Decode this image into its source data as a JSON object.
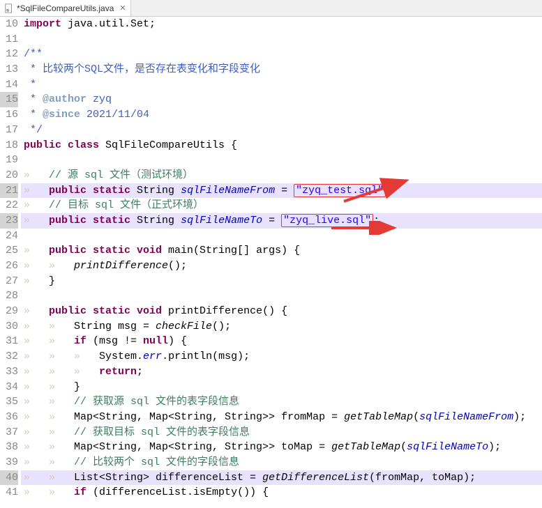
{
  "tab": {
    "title": "*SqlFileCompareUtils.java"
  },
  "firstLine": 10,
  "highlightGutterLines": [
    15,
    21,
    23,
    40
  ],
  "highlightCodeLines": [
    21,
    23,
    40
  ],
  "lines": [
    {
      "n": 10,
      "tokens": [
        {
          "t": "import ",
          "c": "kw"
        },
        {
          "t": "java.util.Set;"
        }
      ]
    },
    {
      "n": 11,
      "tokens": []
    },
    {
      "n": 12,
      "tokens": [
        {
          "t": "/**",
          "c": "jdoc"
        }
      ]
    },
    {
      "n": 13,
      "tokens": [
        {
          "t": " * 比较两个SQL文件，是否存在表变化和字段变化",
          "c": "jdoc"
        }
      ]
    },
    {
      "n": 14,
      "tokens": [
        {
          "t": " * ",
          "c": "jdoc"
        }
      ]
    },
    {
      "n": 15,
      "tokens": [
        {
          "t": " * ",
          "c": "jdoc"
        },
        {
          "t": "@author",
          "c": "jdoc-tag"
        },
        {
          "t": " zyq",
          "c": "jdoc"
        }
      ]
    },
    {
      "n": 16,
      "tokens": [
        {
          "t": " * ",
          "c": "jdoc"
        },
        {
          "t": "@since",
          "c": "jdoc-tag"
        },
        {
          "t": " 2021/11/04",
          "c": "jdoc"
        }
      ]
    },
    {
      "n": 17,
      "tokens": [
        {
          "t": " */",
          "c": "jdoc"
        }
      ]
    },
    {
      "n": 18,
      "tokens": [
        {
          "t": "public class ",
          "c": "kw"
        },
        {
          "t": "SqlFileCompareUtils {"
        }
      ]
    },
    {
      "n": 19,
      "tokens": []
    },
    {
      "n": 20,
      "tokens": [
        {
          "t": "»   ",
          "c": "ws"
        },
        {
          "t": "// 源 sql 文件（测试环境）",
          "c": "comment"
        }
      ]
    },
    {
      "n": 21,
      "tokens": [
        {
          "t": "»   ",
          "c": "ws"
        },
        {
          "t": "public static ",
          "c": "kw"
        },
        {
          "t": "String "
        },
        {
          "t": "sqlFileNameFrom",
          "c": "field-ref"
        },
        {
          "t": " = "
        },
        {
          "t": "\"zyq_test.sql\"",
          "c": "str",
          "box": true
        },
        {
          "t": ";"
        }
      ]
    },
    {
      "n": 22,
      "tokens": [
        {
          "t": "»   ",
          "c": "ws"
        },
        {
          "t": "// 目标 sql 文件（正式环境）",
          "c": "comment"
        }
      ]
    },
    {
      "n": 23,
      "tokens": [
        {
          "t": "»   ",
          "c": "ws"
        },
        {
          "t": "public static ",
          "c": "kw"
        },
        {
          "t": "String "
        },
        {
          "t": "sqlFileNameTo",
          "c": "field-ref"
        },
        {
          "t": " = "
        },
        {
          "t": "\"zyq_live.sql\"",
          "c": "str",
          "box": true
        },
        {
          "t": ";"
        }
      ]
    },
    {
      "n": 24,
      "tokens": []
    },
    {
      "n": 25,
      "tokens": [
        {
          "t": "»   ",
          "c": "ws"
        },
        {
          "t": "public static void ",
          "c": "kw"
        },
        {
          "t": "main(String[] args) {"
        }
      ]
    },
    {
      "n": 26,
      "tokens": [
        {
          "t": "»   »   ",
          "c": "ws"
        },
        {
          "t": "printDifference",
          "c": "method-call"
        },
        {
          "t": "();"
        }
      ]
    },
    {
      "n": 27,
      "tokens": [
        {
          "t": "»   ",
          "c": "ws"
        },
        {
          "t": "}"
        }
      ]
    },
    {
      "n": 28,
      "tokens": []
    },
    {
      "n": 29,
      "tokens": [
        {
          "t": "»   ",
          "c": "ws"
        },
        {
          "t": "public static void ",
          "c": "kw"
        },
        {
          "t": "printDifference() {"
        }
      ]
    },
    {
      "n": 30,
      "tokens": [
        {
          "t": "»   »   ",
          "c": "ws"
        },
        {
          "t": "String msg = "
        },
        {
          "t": "checkFile",
          "c": "method-call"
        },
        {
          "t": "();"
        }
      ]
    },
    {
      "n": 31,
      "tokens": [
        {
          "t": "»   »   ",
          "c": "ws"
        },
        {
          "t": "if ",
          "c": "kw"
        },
        {
          "t": "(msg != "
        },
        {
          "t": "null",
          "c": "kw"
        },
        {
          "t": ") {"
        }
      ]
    },
    {
      "n": 32,
      "tokens": [
        {
          "t": "»   »   »   ",
          "c": "ws"
        },
        {
          "t": "System."
        },
        {
          "t": "err",
          "c": "field-err"
        },
        {
          "t": ".println(msg);"
        }
      ]
    },
    {
      "n": 33,
      "tokens": [
        {
          "t": "»   »   »   ",
          "c": "ws"
        },
        {
          "t": "return",
          "c": "kw"
        },
        {
          "t": ";"
        }
      ]
    },
    {
      "n": 34,
      "tokens": [
        {
          "t": "»   »   ",
          "c": "ws"
        },
        {
          "t": "}"
        }
      ]
    },
    {
      "n": 35,
      "tokens": [
        {
          "t": "»   »   ",
          "c": "ws"
        },
        {
          "t": "// 获取源 sql 文件的表字段信息",
          "c": "comment"
        }
      ]
    },
    {
      "n": 36,
      "tokens": [
        {
          "t": "»   »   ",
          "c": "ws"
        },
        {
          "t": "Map<String, Map<String, String>> fromMap = "
        },
        {
          "t": "getTableMap",
          "c": "method-call"
        },
        {
          "t": "("
        },
        {
          "t": "sqlFileNameFrom",
          "c": "field-ref"
        },
        {
          "t": ");"
        }
      ]
    },
    {
      "n": 37,
      "tokens": [
        {
          "t": "»   »   ",
          "c": "ws"
        },
        {
          "t": "// 获取目标 sql 文件的表字段信息",
          "c": "comment"
        }
      ]
    },
    {
      "n": 38,
      "tokens": [
        {
          "t": "»   »   ",
          "c": "ws"
        },
        {
          "t": "Map<String, Map<String, String>> toMap = "
        },
        {
          "t": "getTableMap",
          "c": "method-call"
        },
        {
          "t": "("
        },
        {
          "t": "sqlFileNameTo",
          "c": "field-ref"
        },
        {
          "t": ");"
        }
      ]
    },
    {
      "n": 39,
      "tokens": [
        {
          "t": "»   »   ",
          "c": "ws"
        },
        {
          "t": "// 比较两个 sql 文件的字段信息",
          "c": "comment"
        }
      ]
    },
    {
      "n": 40,
      "tokens": [
        {
          "t": "»   »   ",
          "c": "ws"
        },
        {
          "t": "List<String> differenceList = "
        },
        {
          "t": "getDifferenceList",
          "c": "method-call"
        },
        {
          "t": "(fromMap, toMap);"
        }
      ]
    },
    {
      "n": 41,
      "tokens": [
        {
          "t": "»   »   ",
          "c": "ws"
        },
        {
          "t": "if ",
          "c": "kw"
        },
        {
          "t": "(differenceList.isEmpty()) {"
        }
      ]
    }
  ]
}
